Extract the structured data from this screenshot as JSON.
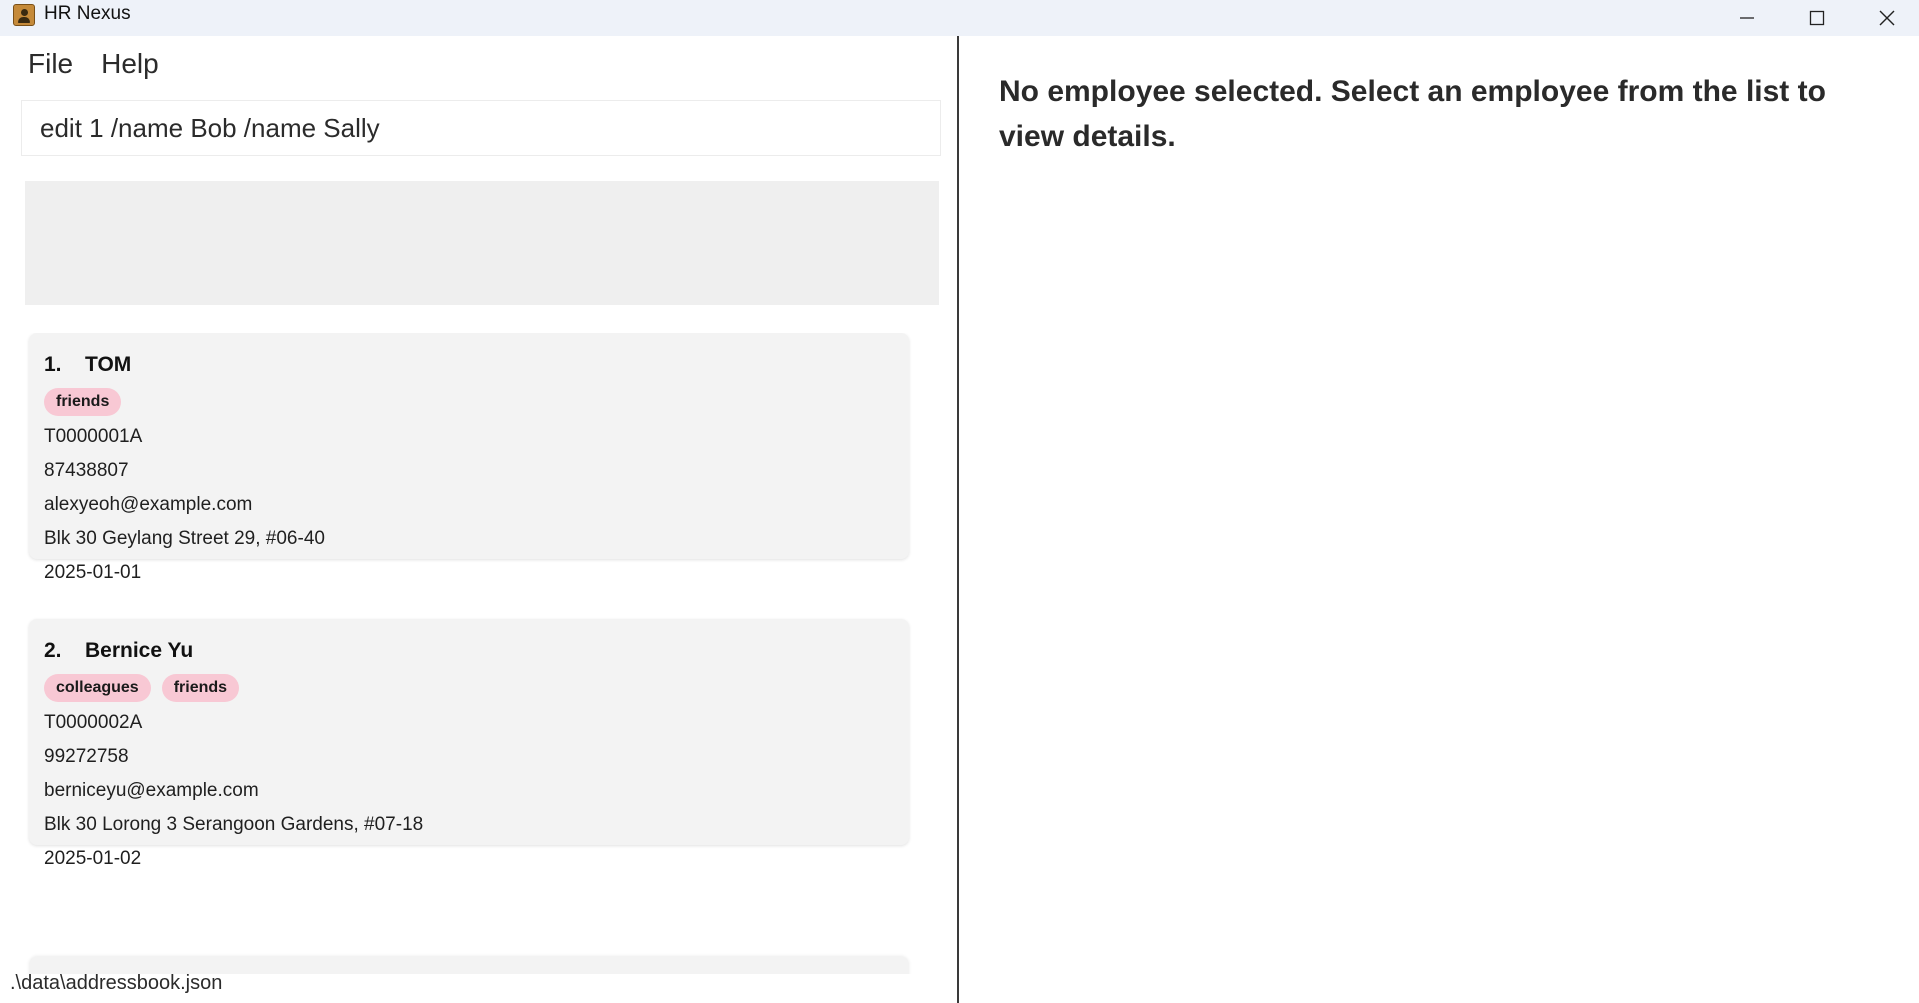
{
  "window": {
    "title": "HR Nexus",
    "icon": "contacts-app-icon"
  },
  "menu": {
    "items": [
      {
        "label": "File"
      },
      {
        "label": "Help"
      }
    ]
  },
  "command": {
    "value": "edit 1 /name Bob /name Sally"
  },
  "result": {
    "text": ""
  },
  "employees": [
    {
      "index": "1.",
      "name": "TOM",
      "tags": [
        "friends"
      ],
      "id": "T0000001A",
      "phone": "87438807",
      "email": "alexyeoh@example.com",
      "address": "Blk 30 Geylang Street 29, #06-40",
      "date": "2025-01-01"
    },
    {
      "index": "2.",
      "name": "Bernice Yu",
      "tags": [
        "colleagues",
        "friends"
      ],
      "id": "T0000002A",
      "phone": "99272758",
      "email": "berniceyu@example.com",
      "address": "Blk 30 Lorong 3 Serangoon Gardens, #07-18",
      "date": "2025-01-02"
    }
  ],
  "status": {
    "path": ".\\data\\addressbook.json"
  },
  "detail": {
    "message": "No employee selected. Select an employee from the list to view details."
  },
  "colors": {
    "titlebar": "#eef2f9",
    "tag": "#f8c8d4",
    "card": "#f3f3f3",
    "result_box": "#efefef"
  }
}
